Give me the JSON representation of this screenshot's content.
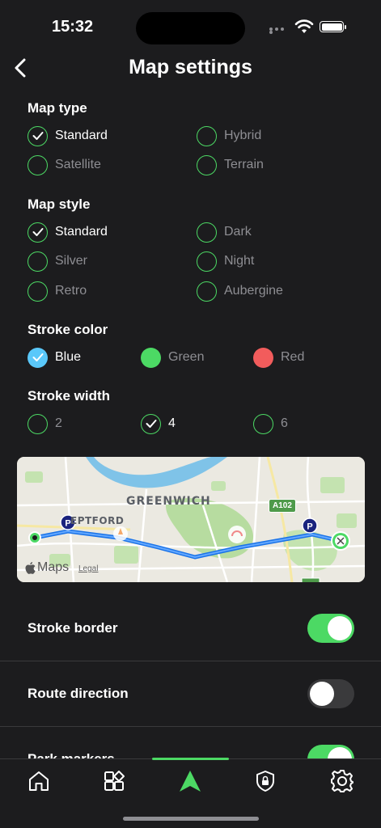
{
  "status": {
    "time": "15:32"
  },
  "header": {
    "title": "Map settings"
  },
  "map_type": {
    "title": "Map type",
    "options": [
      {
        "label": "Standard",
        "selected": true
      },
      {
        "label": "Hybrid",
        "selected": false
      },
      {
        "label": "Satellite",
        "selected": false
      },
      {
        "label": "Terrain",
        "selected": false
      }
    ]
  },
  "map_style": {
    "title": "Map style",
    "options": [
      {
        "label": "Standard",
        "selected": true
      },
      {
        "label": "Dark",
        "selected": false
      },
      {
        "label": "Silver",
        "selected": false
      },
      {
        "label": "Night",
        "selected": false
      },
      {
        "label": "Retro",
        "selected": false
      },
      {
        "label": "Aubergine",
        "selected": false
      }
    ]
  },
  "stroke_color": {
    "title": "Stroke color",
    "options": [
      {
        "label": "Blue",
        "color": "#5ac8fa",
        "selected": true
      },
      {
        "label": "Green",
        "color": "#4cd964",
        "selected": false
      },
      {
        "label": "Red",
        "color": "#f25c5c",
        "selected": false
      }
    ]
  },
  "stroke_width": {
    "title": "Stroke width",
    "options": [
      {
        "label": "2",
        "selected": false
      },
      {
        "label": "4",
        "selected": true
      },
      {
        "label": "6",
        "selected": false
      }
    ]
  },
  "map_preview": {
    "place_main": "GREENWICH",
    "place_secondary": "EPTFORD",
    "road_shield": "A102",
    "attribution": "Maps",
    "legal": "Legal"
  },
  "settings": [
    {
      "label": "Stroke border",
      "on": true
    },
    {
      "label": "Route direction",
      "on": false
    },
    {
      "label": "Park markers",
      "on": true
    }
  ],
  "tabs": [
    {
      "name": "home-icon",
      "active": false
    },
    {
      "name": "grid-icon",
      "active": false
    },
    {
      "name": "navigation-arrow-icon",
      "active": true
    },
    {
      "name": "shield-lock-icon",
      "active": false
    },
    {
      "name": "gear-icon",
      "active": false
    }
  ],
  "colors": {
    "accent": "#4cd964",
    "background": "#1c1c1e",
    "route": "#1a73e8"
  }
}
